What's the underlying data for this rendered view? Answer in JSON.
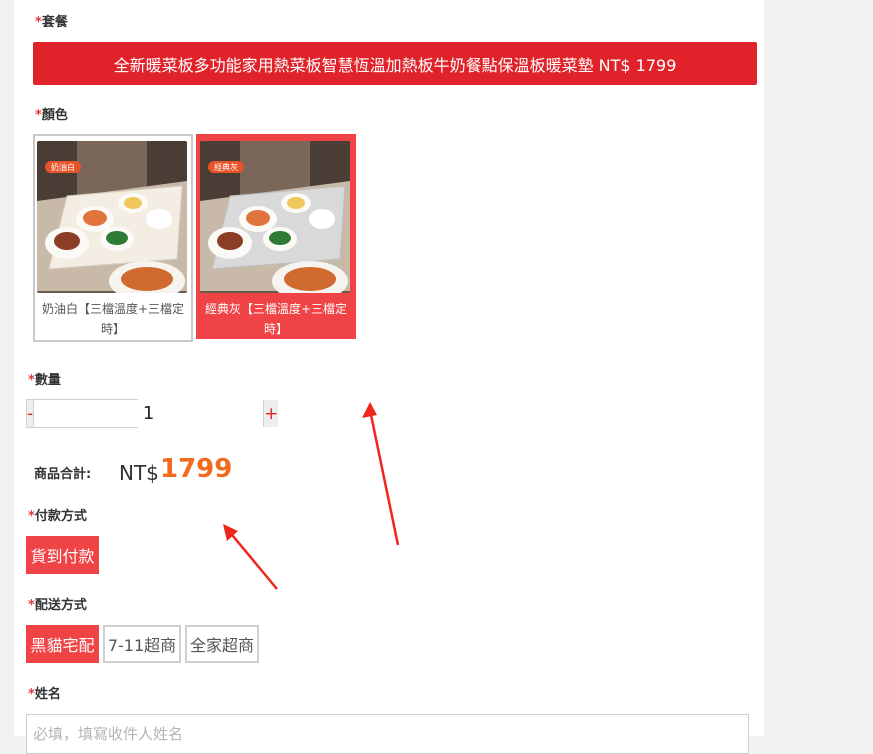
{
  "package": {
    "label": "套餐",
    "selected": "全新暖菜板多功能家用熱菜板智慧恆溫加熱板牛奶餐點保溫板暖菜墊 NT$ 1799"
  },
  "color": {
    "label": "顏色",
    "options": [
      {
        "tag": "奶油白",
        "caption": "奶油白【三檔溫度+三檔定時】",
        "selected": false
      },
      {
        "tag": "經典灰",
        "caption": "經典灰【三檔溫度+三檔定時】",
        "selected": true
      }
    ]
  },
  "quantity": {
    "label": "數量",
    "minus": "-",
    "plus": "+",
    "value": "1"
  },
  "total": {
    "label": "商品合計:",
    "currency": "NT$",
    "amount": "1799"
  },
  "payment": {
    "label": "付款方式",
    "options": [
      {
        "label": "貨到付款",
        "selected": true
      }
    ]
  },
  "shipping": {
    "label": "配送方式",
    "options": [
      {
        "label": "黑貓宅配",
        "selected": true
      },
      {
        "label": "7-11超商",
        "selected": false
      },
      {
        "label": "全家超商",
        "selected": false
      }
    ]
  },
  "name": {
    "label": "姓名",
    "placeholder": "必填，填寫收件人姓名",
    "value": ""
  },
  "required_mark": "*",
  "colors": {
    "accent": "#e0232a",
    "selected": "#ef4346",
    "price": "#f26b1d"
  }
}
